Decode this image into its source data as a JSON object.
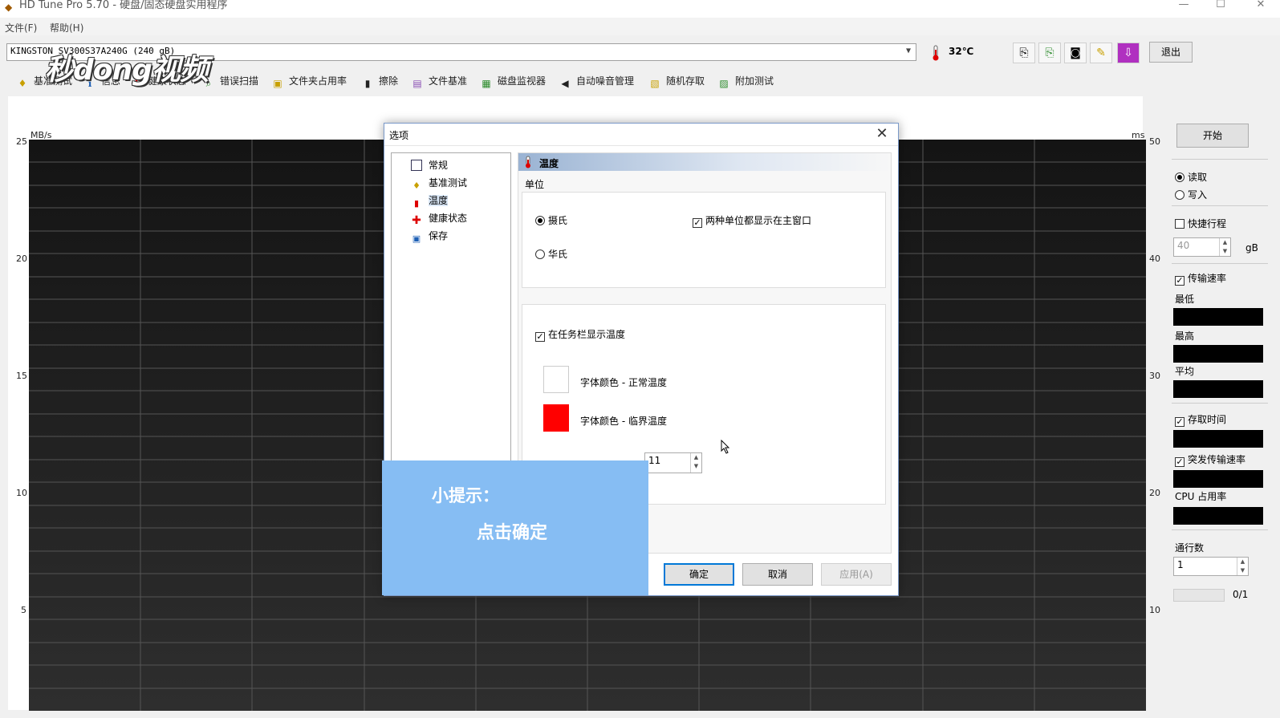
{
  "window": {
    "title": "HD Tune Pro 5.70 - 硬盘/固态硬盘实用程序",
    "controls": {
      "minimize": "—",
      "maximize": "☐",
      "close": "✕"
    }
  },
  "menu": {
    "file": "文件(F)",
    "help": "帮助(H)"
  },
  "toolbar": {
    "drive": "KINGSTON SV300S37A240G (240 gB)",
    "temperature": "32℃",
    "exit_label": "退出",
    "icons": [
      "copy-info-icon",
      "copy-all-icon",
      "screenshot-icon",
      "options-icon",
      "save-icon"
    ]
  },
  "tabs": [
    {
      "label": "基准测试",
      "icon": "benchmark-icon"
    },
    {
      "label": "信息",
      "icon": "info-icon"
    },
    {
      "label": "健康状态",
      "icon": "health-icon"
    },
    {
      "label": "错误扫描",
      "icon": "error-scan-icon"
    },
    {
      "label": "文件夹占用率",
      "icon": "folder-usage-icon"
    },
    {
      "label": "擦除",
      "icon": "erase-icon"
    },
    {
      "label": "文件基准",
      "icon": "file-benchmark-icon"
    },
    {
      "label": "磁盘监视器",
      "icon": "disk-monitor-icon"
    },
    {
      "label": "自动噪音管理",
      "icon": "aam-icon"
    },
    {
      "label": "随机存取",
      "icon": "random-access-icon"
    },
    {
      "label": "附加测试",
      "icon": "extra-tests-icon"
    }
  ],
  "chart": {
    "left_unit": "MB/s",
    "right_unit": "ms",
    "left_ticks": [
      "25",
      "20",
      "15",
      "10",
      "5"
    ],
    "right_ticks": [
      "50",
      "40",
      "30",
      "20",
      "10"
    ]
  },
  "right_panel": {
    "start_label": "开始",
    "read_label": "读取",
    "write_label": "写入",
    "short_stroke_label": "快捷行程",
    "short_stroke_value": "40",
    "short_stroke_unit": "gB",
    "transfer_rate_label": "传输速率",
    "min_label": "最低",
    "max_label": "最高",
    "avg_label": "平均",
    "access_time_label": "存取时间",
    "burst_rate_label": "突发传输速率",
    "cpu_label": "CPU 占用率",
    "passes_label": "通行数",
    "passes_value": "1",
    "progress_text": "0/1"
  },
  "dialog": {
    "title": "选项",
    "tree": [
      {
        "label": "常规",
        "icon": "general-icon"
      },
      {
        "label": "基准测试",
        "icon": "benchmark-icon"
      },
      {
        "label": "温度",
        "icon": "thermometer-icon"
      },
      {
        "label": "健康状态",
        "icon": "health-icon"
      },
      {
        "label": "保存",
        "icon": "save-icon"
      }
    ],
    "panel_title": "温度",
    "unit_group_label": "单位",
    "celsius_label": "摄氏",
    "fahrenheit_label": "华氏",
    "both_units_label": "两种单位都显示在主窗口",
    "taskbar_label": "在任务栏显示温度",
    "normal_color_label": "字体颜色 - 正常温度",
    "critical_color_label": "字体颜色 - 临界温度",
    "critical_value": "11",
    "ok_label": "确定",
    "cancel_label": "取消",
    "apply_label": "应用(A)"
  },
  "tip": {
    "title": "小提示：",
    "body": "点击确定"
  },
  "watermark": "秒dong视频",
  "colors": {
    "critical": "#ff0000",
    "tip_bg": "#86bdf3",
    "accent": "#0078d7"
  }
}
